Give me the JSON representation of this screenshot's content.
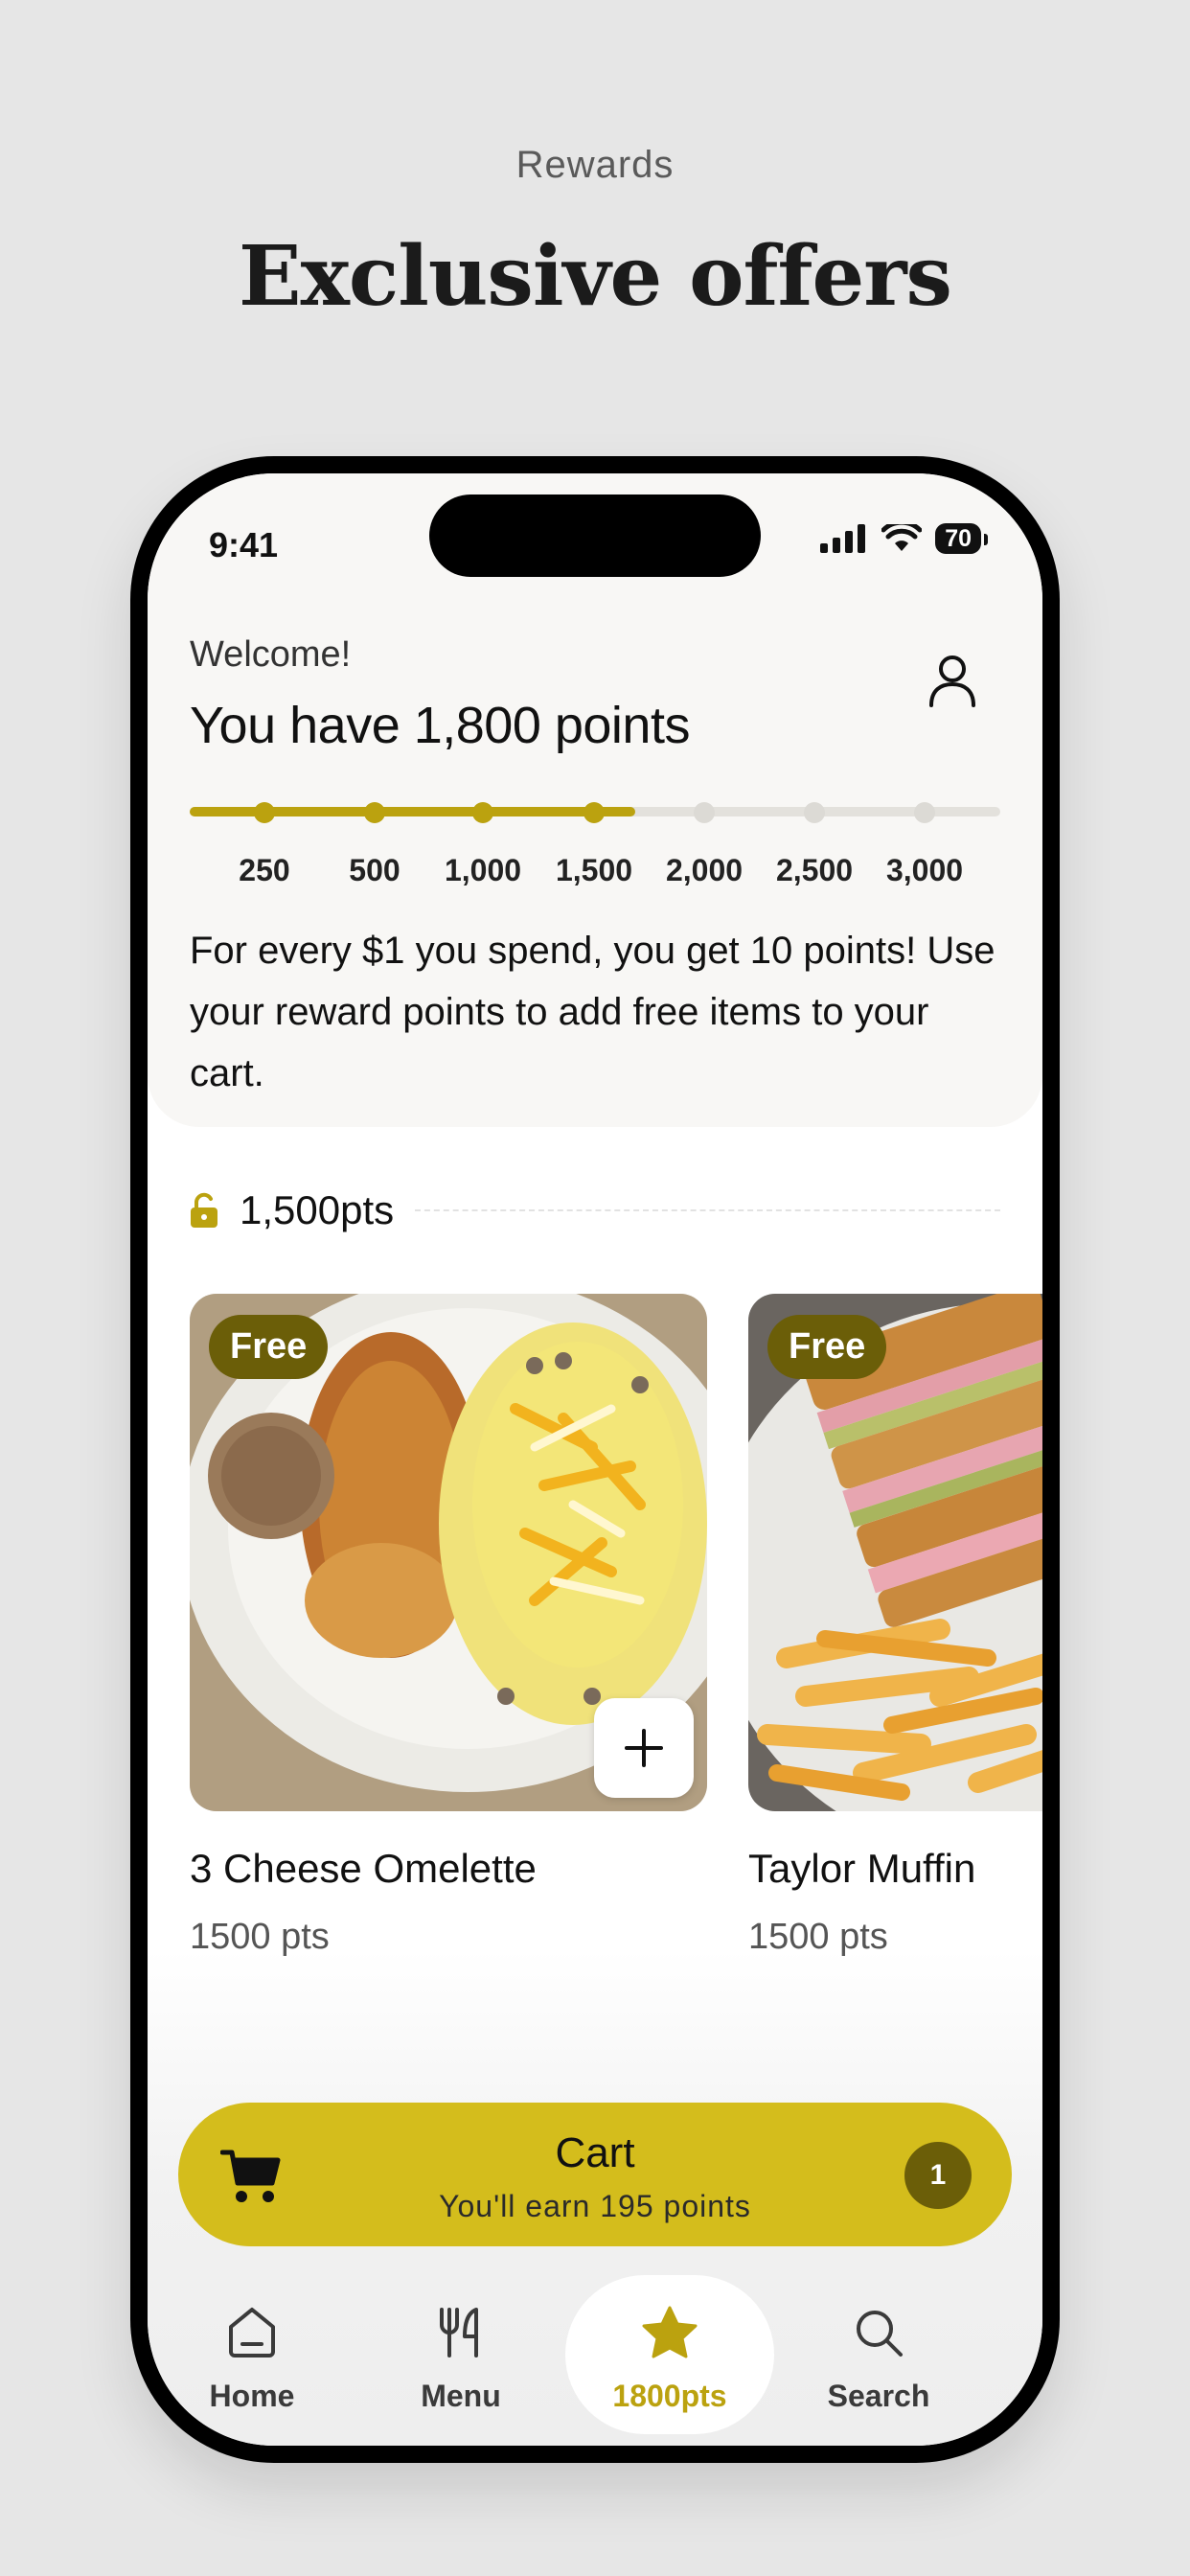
{
  "page": {
    "eyebrow": "Rewards",
    "headline": "Exclusive offers"
  },
  "status_bar": {
    "time": "9:41",
    "battery": "70",
    "icons": [
      "signal-icon",
      "wifi-icon",
      "battery-icon"
    ]
  },
  "header": {
    "welcome": "Welcome!",
    "points_title": "You have 1,800 points",
    "profile_icon": "person-icon"
  },
  "progress": {
    "current_points": 1800,
    "fill_fraction": 0.55,
    "milestones": [
      {
        "label": "250",
        "reached": true
      },
      {
        "label": "500",
        "reached": true
      },
      {
        "label": "1,000",
        "reached": true
      },
      {
        "label": "1,500",
        "reached": true
      },
      {
        "label": "2,000",
        "reached": false
      },
      {
        "label": "2,500",
        "reached": false
      },
      {
        "label": "3,000",
        "reached": false
      }
    ]
  },
  "description": "For every $1 you spend, you get 10 points! Use your reward points to add free items to your cart.",
  "tier": {
    "label": "1,500pts",
    "icon": "unlock-icon"
  },
  "items": [
    {
      "badge": "Free",
      "name": "3 Cheese Omelette",
      "points": "1500 pts"
    },
    {
      "badge": "Free",
      "name": "Taylor Muffin",
      "points": "1500 pts"
    }
  ],
  "cart": {
    "title": "Cart",
    "subtitle": "You'll earn 195 points",
    "count": "1",
    "icon": "cart-icon"
  },
  "nav": {
    "items": [
      {
        "label": "Home",
        "icon": "home-icon",
        "active": false
      },
      {
        "label": "Menu",
        "icon": "fork-knife-icon",
        "active": false
      },
      {
        "label": "1800pts",
        "icon": "star-icon",
        "active": true
      },
      {
        "label": "Search",
        "icon": "search-icon",
        "active": false
      }
    ]
  },
  "colors": {
    "accent": "#d4bd1c",
    "accent_dark": "#bba20f",
    "badge": "#6b5e08"
  }
}
